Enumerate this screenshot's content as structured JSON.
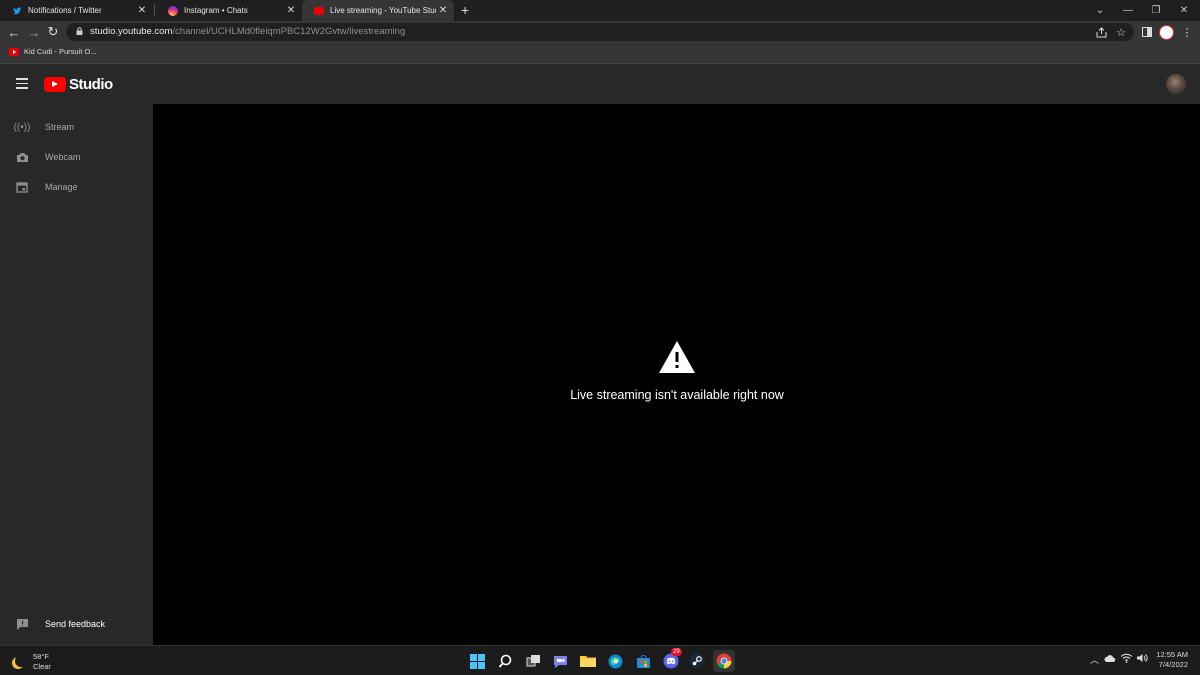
{
  "browser": {
    "tabs": [
      {
        "title": "Notifications / Twitter",
        "icon": "twitter-icon",
        "active": false
      },
      {
        "title": "Instagram • Chats",
        "icon": "instagram-icon",
        "active": false
      },
      {
        "title": "Live streaming - YouTube Studio",
        "icon": "youtube-icon",
        "active": true
      }
    ],
    "new_tab_glyph": "+",
    "url_host": "studio.youtube.com",
    "url_path": "/channel/UCHLMd0fleiqmPBC12W2Gvtw/livestreaming",
    "bookmarks": [
      {
        "label": "Kid Cudi - Pursuit O...",
        "icon": "youtube-icon"
      }
    ]
  },
  "studio": {
    "logo_text": "Studio",
    "sidebar": {
      "items": [
        {
          "label": "Stream",
          "icon": "broadcast-icon"
        },
        {
          "label": "Webcam",
          "icon": "camera-icon"
        },
        {
          "label": "Manage",
          "icon": "calendar-icon"
        }
      ],
      "feedback": {
        "label": "Send feedback",
        "icon": "feedback-icon"
      }
    },
    "main": {
      "message": "Live streaming isn't available right now",
      "icon": "warning-icon"
    }
  },
  "taskbar": {
    "weather": {
      "temp": "58°F",
      "condition": "Clear"
    },
    "apps": [
      "start-icon",
      "search-icon",
      "task-view-icon",
      "teams-chat-icon",
      "file-explorer-icon",
      "edge-icon",
      "store-icon",
      "discord-icon",
      "steam-icon",
      "chrome-icon"
    ],
    "discord_badge": "29",
    "clock": {
      "time": "12:55 AM",
      "date": "7/4/2022"
    }
  },
  "colors": {
    "youtube_red": "#ff0000",
    "sidebar_bg": "#282828",
    "main_bg": "#000000"
  }
}
